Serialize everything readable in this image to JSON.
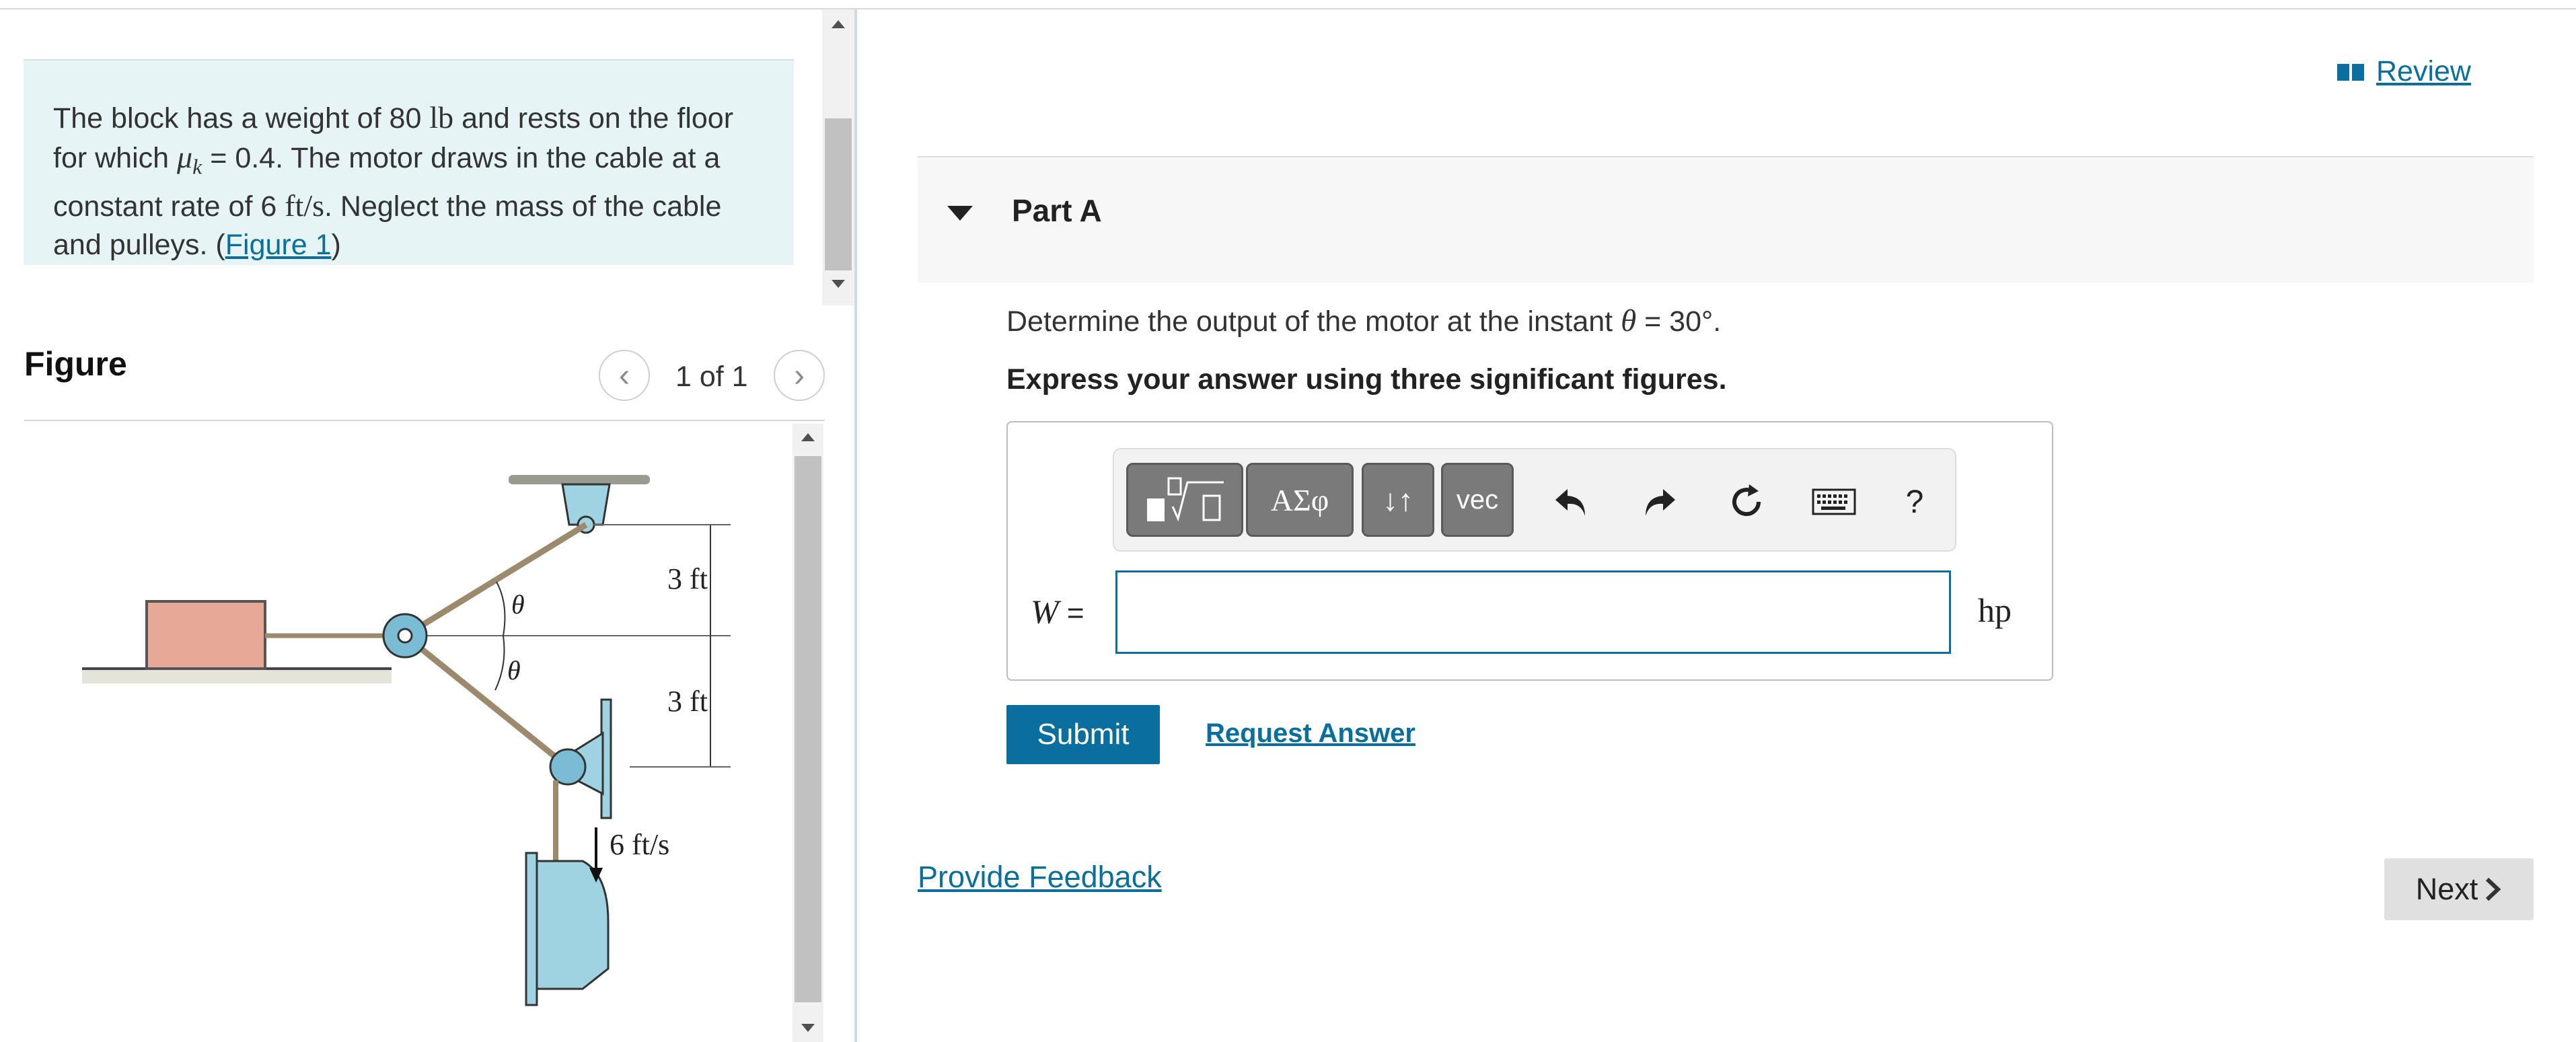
{
  "problem": {
    "text_1": "The block has a weight of 80 ",
    "weight_unit": "lb",
    "text_2": " and rests on the floor for which ",
    "mu_symbol": "μ",
    "mu_sub": "k",
    "text_3": " = 0.4. The motor draws in the cable at a constant rate of 6 ",
    "rate_unit": "ft/s",
    "text_4": ". Neglect the mass of the cable and pulleys. (",
    "figure_link": "Figure 1",
    "text_5": ")"
  },
  "figure_panel": {
    "title": "Figure",
    "prev_icon": "chevron-left",
    "next_icon": "chevron-right",
    "page_count": "1 of 1",
    "labels": {
      "dist_top": "3 ft",
      "dist_bottom": "3 ft",
      "theta_top": "θ",
      "theta_bottom": "θ",
      "velocity": "6 ft/s"
    }
  },
  "review": {
    "icon": "book-icon",
    "label": "Review"
  },
  "part": {
    "title": "Part A"
  },
  "question": {
    "text_1": "Determine the output of the motor at the instant ",
    "theta": "θ",
    "text_2": " = 30°."
  },
  "instruction": "Express your answer using three significant figures.",
  "toolbar": {
    "templates_icon": "fraction-sqrt-template",
    "greek_label": "ΑΣφ",
    "arrows_label": "↓↑",
    "vec_label": "vec",
    "undo_icon": "undo-arrow",
    "redo_icon": "redo-arrow",
    "reset_icon": "reset",
    "keyboard_icon": "keyboard",
    "help_label": "?"
  },
  "answer": {
    "var": "W",
    "equals": " =",
    "value": "",
    "unit": "hp"
  },
  "actions": {
    "submit": "Submit",
    "request_answer": "Request Answer",
    "feedback": "Provide Feedback",
    "next": "Next"
  },
  "colors": {
    "accent": "#0a6f9e",
    "problem_bg": "#e6f4f5",
    "toolbar_btn": "#7a7a7a",
    "next_bg": "#e0e0e0"
  }
}
